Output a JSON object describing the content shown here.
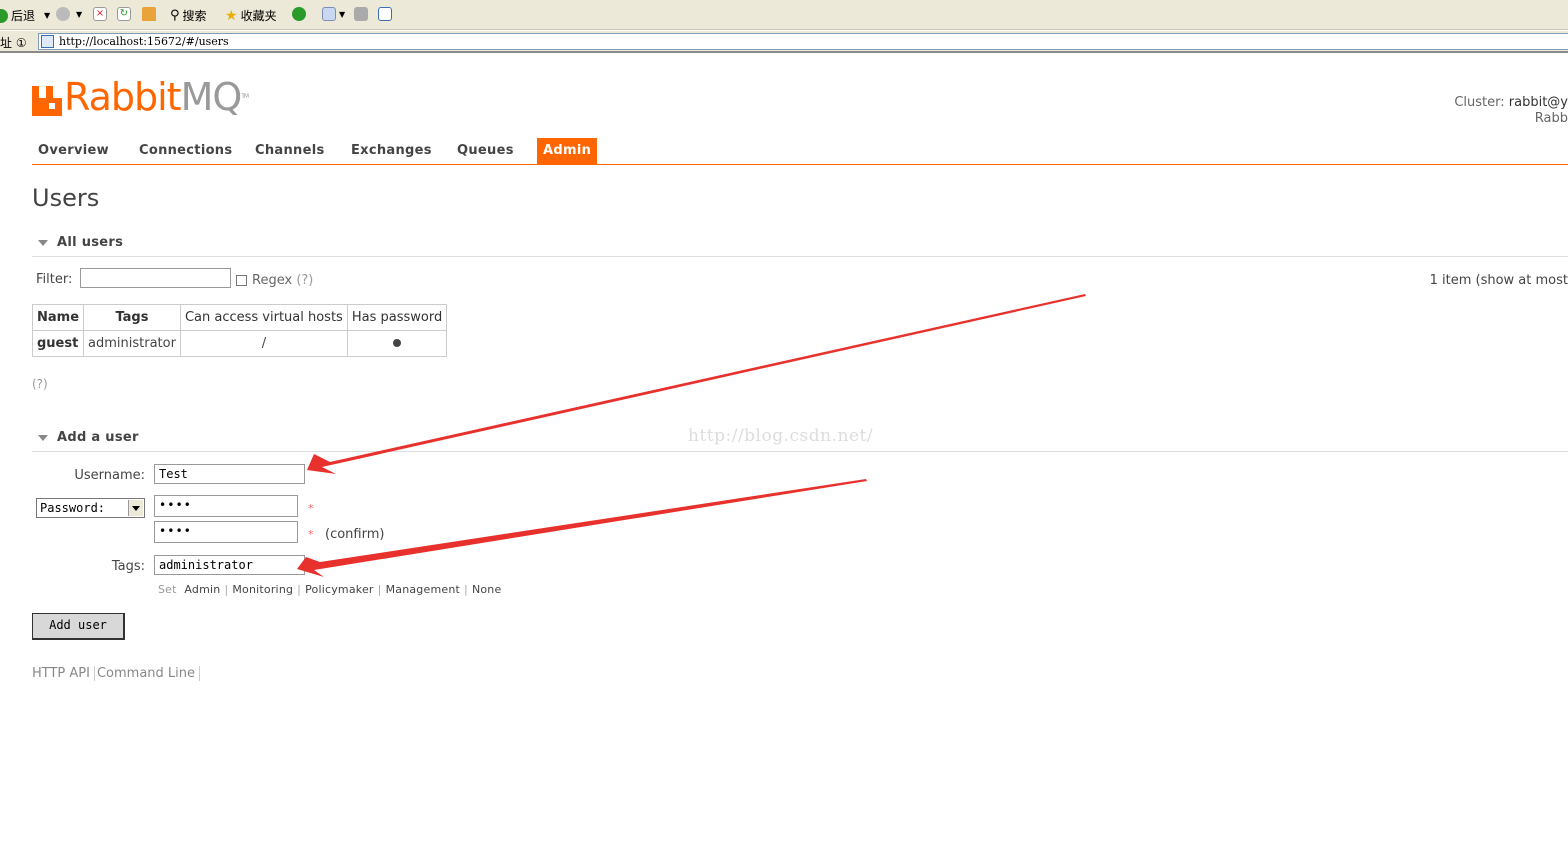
{
  "browser": {
    "toolbar": {
      "back_label": "后退",
      "search_label": "搜索",
      "favorites_label": "收藏夹"
    },
    "address": {
      "label": "址 ①",
      "url": "http://localhost:15672/#/users"
    }
  },
  "app": {
    "logo": {
      "rabbit": "Rabbit",
      "mq": "MQ",
      "tm": "TM"
    },
    "cluster": {
      "label": "Cluster:",
      "value": "rabbit@y",
      "line2": "Rabb"
    },
    "nav": [
      {
        "label": "Overview",
        "active": false
      },
      {
        "label": "Connections",
        "active": false
      },
      {
        "label": "Channels",
        "active": false
      },
      {
        "label": "Exchanges",
        "active": false
      },
      {
        "label": "Queues",
        "active": false
      },
      {
        "label": "Admin",
        "active": true
      }
    ],
    "accent_color": "#ff6600"
  },
  "page": {
    "title": "Users",
    "all_users": {
      "header": "All users",
      "filter_label": "Filter:",
      "filter_value": "",
      "regex_label": "Regex",
      "regex_help": "(?)",
      "regex_checked": false,
      "items_count": "1 item (show at most",
      "table": {
        "columns": [
          "Name",
          "Tags",
          "Can access virtual hosts",
          "Has password"
        ],
        "rows": [
          {
            "name": "guest",
            "tags": "administrator",
            "vhosts": "/",
            "has_password": true
          }
        ]
      },
      "help": "(?)"
    },
    "add_user": {
      "header": "Add a user",
      "username_label": "Username:",
      "username_value": "Test",
      "password_mode": "Password:",
      "password_value": "••••",
      "confirm_value": "••••",
      "required_mark": "*",
      "confirm_label": "(confirm)",
      "tags_label": "Tags:",
      "tags_value": "administrator",
      "tag_set_label": "Set",
      "tag_options": [
        "Admin",
        "Monitoring",
        "Policymaker",
        "Management",
        "None"
      ],
      "submit_label": "Add user"
    },
    "footer": {
      "http_api": "HTTP API",
      "command_line": "Command Line"
    }
  },
  "annotation": {
    "watermark": "http://blog.csdn.net/",
    "arrow_color": "#e8312c"
  }
}
